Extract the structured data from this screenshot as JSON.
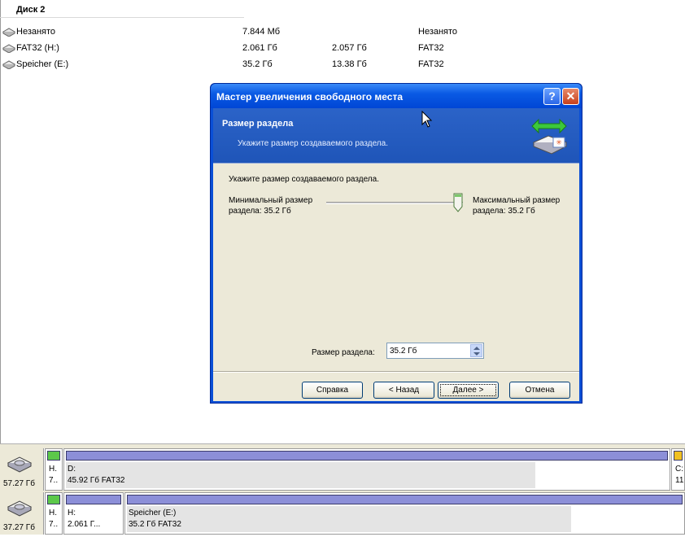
{
  "disk_list": {
    "disk_title": "Диск 2",
    "rows": [
      {
        "name": "Незанято",
        "size": "7.844 Мб",
        "used": "",
        "type": "Незанято"
      },
      {
        "name": "FAT32 (H:)",
        "size": "2.061 Гб",
        "used": "2.057 Гб",
        "type": "FAT32"
      },
      {
        "name": "Speicher (E:)",
        "size": "35.2 Гб",
        "used": "13.38 Гб",
        "type": "FAT32"
      }
    ]
  },
  "disk_map": {
    "disk1": {
      "capacity": "57.27 Гб",
      "parts": [
        {
          "line1": "H.",
          "line2": "7..",
          "color": "#5cc84a"
        },
        {
          "line1": "D:",
          "line2": "45.92 Гб  FAT32",
          "color": "#8c8fd8",
          "used_fraction": 0.78
        },
        {
          "line1": "C:",
          "line2": "11",
          "color": "#f0c020"
        }
      ]
    },
    "disk2": {
      "capacity": "37.27 Гб",
      "parts": [
        {
          "line1": "H.",
          "line2": "7..",
          "color": "#5cc84a"
        },
        {
          "line1": "H:",
          "line2": "2.061 Г...",
          "color": "#8c8fd8"
        },
        {
          "line1": "Speicher (E:)",
          "line2": "35.2 Гб  FAT32",
          "color": "#8c8fd8",
          "used_fraction": 0.8
        }
      ]
    }
  },
  "wizard": {
    "title": "Мастер увеличения свободного места",
    "header": "Размер раздела",
    "subheader": "Укажите размер создаваемого раздела.",
    "instruction": "Укажите размер создаваемого раздела.",
    "min_label_1": "Минимальный размер",
    "min_label_2": "раздела: 35.2 Гб",
    "max_label_1": "Максимальный размер",
    "max_label_2": "раздела: 35.2 Гб",
    "slider_position": 1.0,
    "size_field_label": "Размер раздела:",
    "size_value": "35.2 Гб",
    "buttons": {
      "help": "Справка",
      "back": "< Назад",
      "next": "Далее >",
      "cancel": "Отмена"
    },
    "title_help_glyph": "?",
    "title_close_glyph": "✕"
  }
}
